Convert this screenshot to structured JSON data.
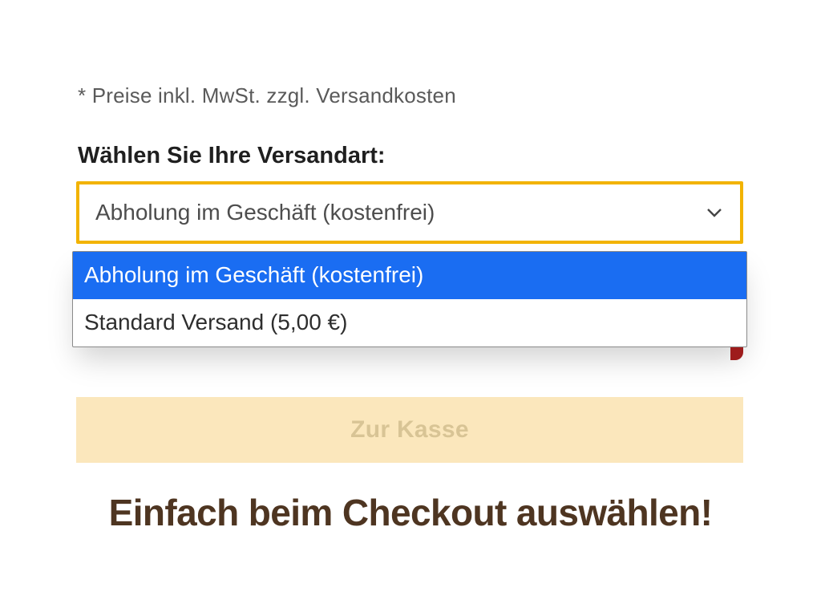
{
  "fine_print": "* Preise inkl. MwSt. zzgl. Versandkosten",
  "section_heading": "Wählen Sie Ihre Versandart:",
  "shipping_select": {
    "value_label": "Abholung im Geschäft (kostenfrei)",
    "options": [
      "Abholung im Geschäft (kostenfrei)",
      "Standard Versand (5,00 €)"
    ]
  },
  "checkout_button_label": "Zur Kasse",
  "caption": "Einfach beim Checkout auswählen!"
}
